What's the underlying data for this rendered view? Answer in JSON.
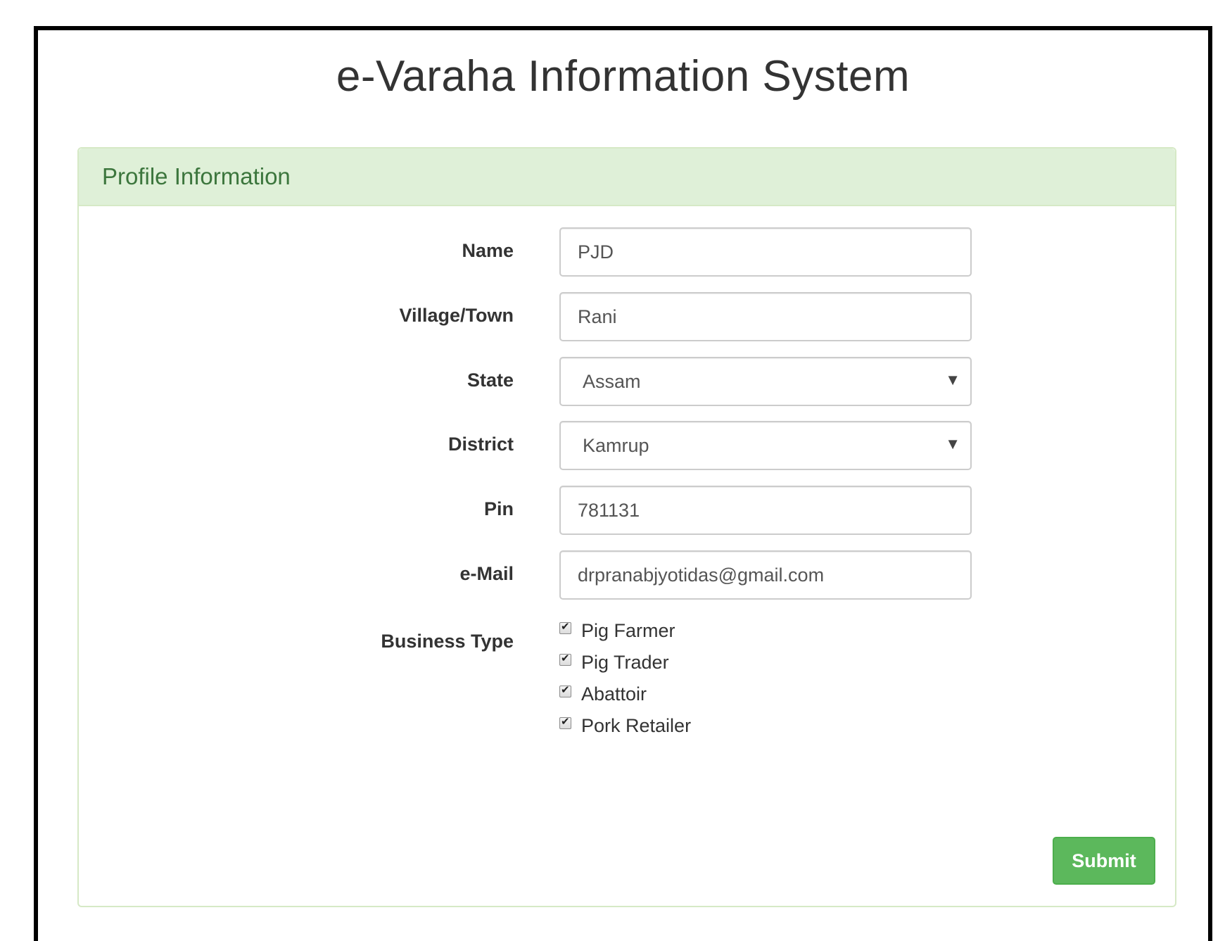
{
  "app": {
    "title": "e-Varaha Information System"
  },
  "panel": {
    "heading": "Profile Information"
  },
  "form": {
    "name": {
      "label": "Name",
      "value": "PJD"
    },
    "village": {
      "label": "Village/Town",
      "value": "Rani"
    },
    "state": {
      "label": "State",
      "selected": "Assam",
      "caret": "▼"
    },
    "district": {
      "label": "District",
      "selected": "Kamrup",
      "caret": "▼"
    },
    "pin": {
      "label": "Pin",
      "value": "781131"
    },
    "email": {
      "label": "e-Mail",
      "value": "drpranabjyotidas@gmail.com"
    },
    "business_type": {
      "label": "Business Type",
      "options": [
        {
          "label": "Pig Farmer",
          "checked": true
        },
        {
          "label": "Pig Trader",
          "checked": true
        },
        {
          "label": "Abattoir",
          "checked": true
        },
        {
          "label": "Pork Retailer",
          "checked": true
        }
      ]
    },
    "submit_label": "Submit"
  },
  "colors": {
    "panel_heading_bg": "#dff0d8",
    "panel_heading_text": "#3c763d",
    "submit_bg": "#5cb85c"
  },
  "icons": {
    "checkbox_check": "check-icon",
    "select_caret": "caret-down-icon"
  }
}
